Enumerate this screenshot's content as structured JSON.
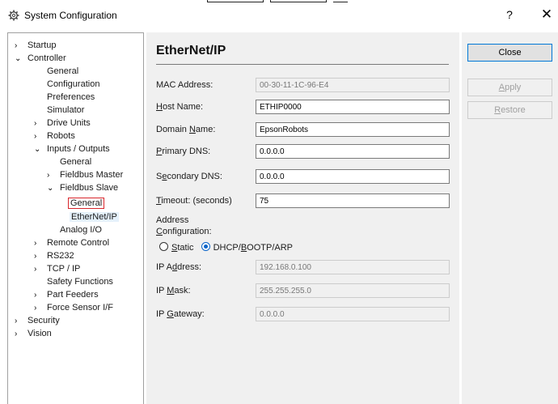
{
  "window": {
    "title": "System Configuration",
    "help_label": "?",
    "close_label": "✕"
  },
  "tree": {
    "items": [
      {
        "label": "Startup",
        "chev": "›"
      },
      {
        "label": "Controller",
        "chev": "⌄"
      },
      {
        "label": "General",
        "chev": ""
      },
      {
        "label": "Configuration",
        "chev": ""
      },
      {
        "label": "Preferences",
        "chev": ""
      },
      {
        "label": "Simulator",
        "chev": ""
      },
      {
        "label": "Drive Units",
        "chev": "›"
      },
      {
        "label": "Robots",
        "chev": "›"
      },
      {
        "label": "Inputs / Outputs",
        "chev": "⌄"
      },
      {
        "label": "General",
        "chev": ""
      },
      {
        "label": "Fieldbus Master",
        "chev": "›"
      },
      {
        "label": "Fieldbus Slave",
        "chev": "⌄"
      },
      {
        "label": "General",
        "chev": ""
      },
      {
        "label": "EtherNet/IP",
        "chev": ""
      },
      {
        "label": "Analog I/O",
        "chev": ""
      },
      {
        "label": "Remote Control",
        "chev": "›"
      },
      {
        "label": "RS232",
        "chev": "›"
      },
      {
        "label": "TCP / IP",
        "chev": "›"
      },
      {
        "label": "Safety Functions",
        "chev": ""
      },
      {
        "label": "Part Feeders",
        "chev": "›"
      },
      {
        "label": "Force Sensor I/F",
        "chev": "›"
      },
      {
        "label": "Security",
        "chev": "›"
      },
      {
        "label": "Vision",
        "chev": "›"
      }
    ]
  },
  "content": {
    "heading": "EtherNet/IP",
    "mac_label": "MAC Address:",
    "mac_value": "00-30-11-1C-96-E4",
    "host_label_u": "H",
    "host_label_rest": "ost Name:",
    "host_value": "ETHIP0000",
    "domain_label_pre": "Domain ",
    "domain_label_u": "N",
    "domain_label_rest": "ame:",
    "domain_value": "EpsonRobots",
    "pdns_label_u": "P",
    "pdns_label_rest": "rimary DNS:",
    "pdns_value": "0.0.0.0",
    "sdns_label_pre": "S",
    "sdns_label_u": "e",
    "sdns_label_rest": "condary DNS:",
    "sdns_value": "0.0.0.0",
    "timeout_label_u": "T",
    "timeout_label_rest": "imeout: (seconds)",
    "timeout_value": "75",
    "addr_cfg_line1": "Address",
    "addr_cfg_line2_u": "C",
    "addr_cfg_line2_rest": "onfiguration:",
    "radio_static_u": "S",
    "radio_static_rest": "tatic",
    "radio_dhcp_pre": "DHCP/",
    "radio_dhcp_u": "B",
    "radio_dhcp_rest": "OOTP/ARP",
    "ip_label_pre": "IP A",
    "ip_label_u": "d",
    "ip_label_rest": "dress:",
    "ip_value": "192.168.0.100",
    "mask_label_pre": "IP ",
    "mask_label_u": "M",
    "mask_label_rest": "ask:",
    "mask_value": "255.255.255.0",
    "gw_label_pre": "IP ",
    "gw_label_u": "G",
    "gw_label_rest": "ateway:",
    "gw_value": "0.0.0.0"
  },
  "buttons": {
    "close": "Close",
    "apply_u": "A",
    "apply_rest": "pply",
    "restore_u": "R",
    "restore_rest": "estore"
  }
}
